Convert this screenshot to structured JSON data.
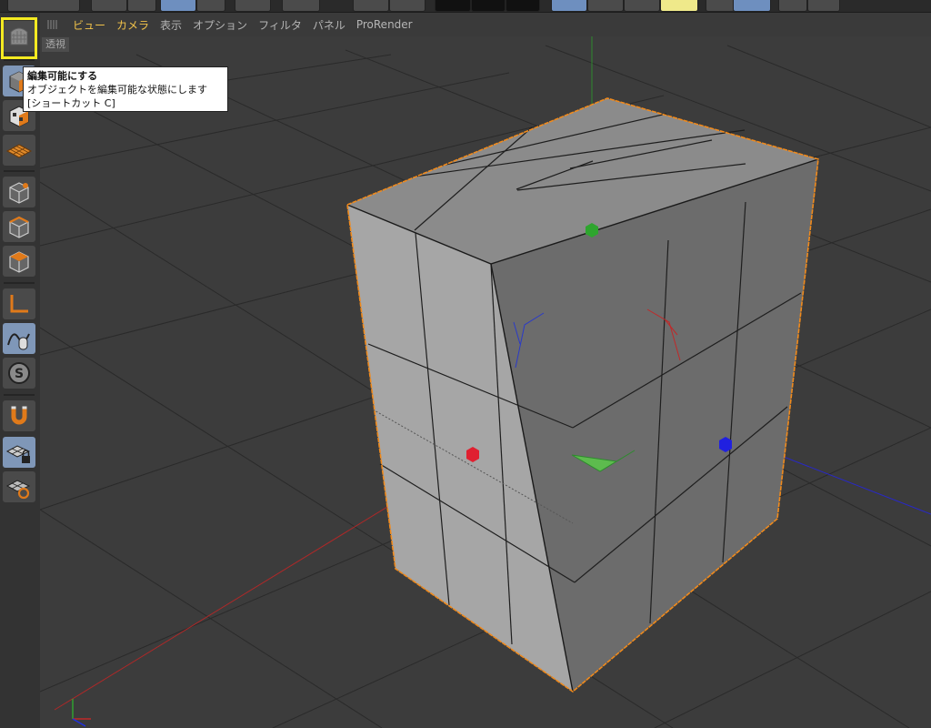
{
  "viewport_menu": {
    "items": [
      {
        "label": "ビュー",
        "active": true
      },
      {
        "label": "カメラ",
        "active": true
      },
      {
        "label": "表示",
        "active": false
      },
      {
        "label": "オプション",
        "active": false
      },
      {
        "label": "フィルタ",
        "active": false
      },
      {
        "label": "パネル",
        "active": false
      },
      {
        "label": "ProRender",
        "active": false
      }
    ]
  },
  "viewport": {
    "label": "透視"
  },
  "tooltip": {
    "title": "編集可能にする",
    "description": "オブジェクトを編集可能な状態にします",
    "shortcut": "[ショートカット C]"
  },
  "left_palette": {
    "tools": [
      {
        "name": "make-editable-icon",
        "active": false
      },
      {
        "name": "model-mode-icon",
        "active": true
      },
      {
        "name": "texture-mode-icon",
        "active": false
      },
      {
        "name": "workplane-mode-icon",
        "active": false
      },
      {
        "name": "points-mode-icon",
        "active": false
      },
      {
        "name": "edges-mode-icon",
        "active": false
      },
      {
        "name": "polygons-mode-icon",
        "active": false
      },
      {
        "name": "axis-mode-icon",
        "active": false
      },
      {
        "name": "tweak-mode-icon",
        "active": true
      },
      {
        "name": "snap-icon",
        "active": false
      },
      {
        "name": "magnet-icon",
        "active": false
      },
      {
        "name": "workplane-lock-icon",
        "active": true
      },
      {
        "name": "workplane-align-icon",
        "active": false
      }
    ]
  },
  "colors": {
    "accent": "#f0c24a",
    "selection_outline": "#f08a1c",
    "highlight_box": "#f4ea21",
    "x_axis": "#e02030",
    "y_axis": "#30a030",
    "z_axis": "#2030e0"
  }
}
